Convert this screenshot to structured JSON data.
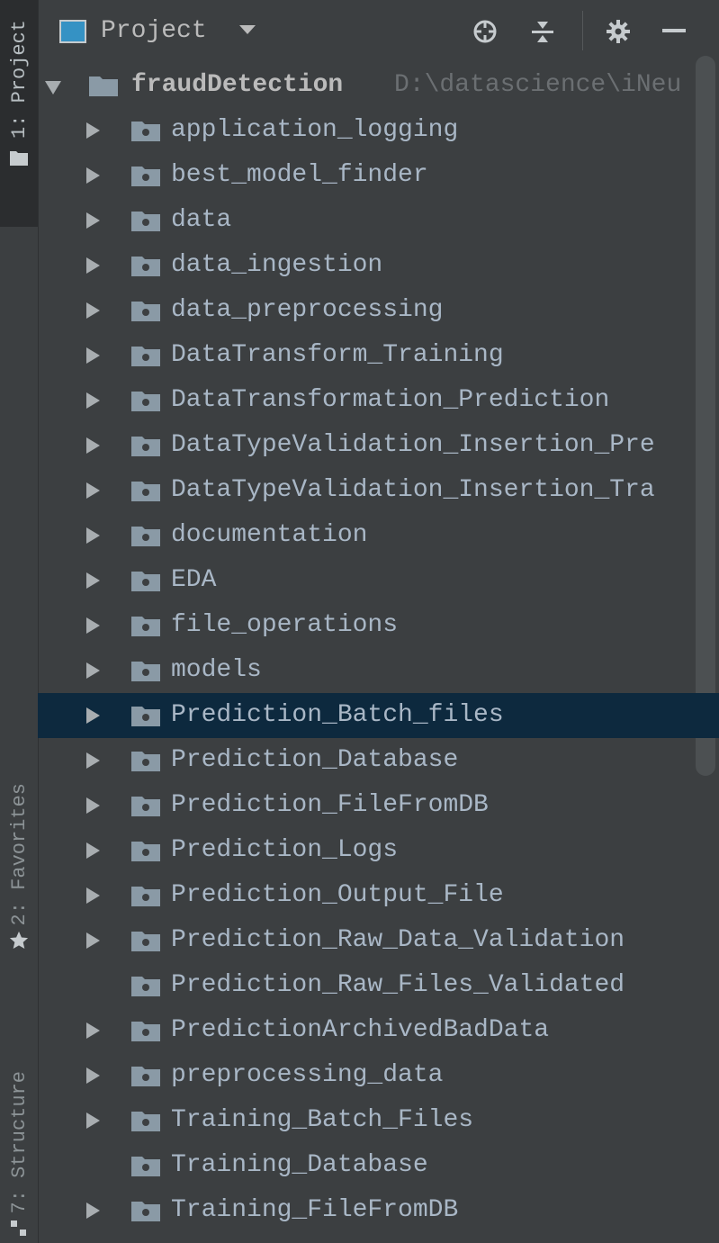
{
  "toolstrip": {
    "project_tab": "1: Project",
    "favorites_tab": "2: Favorites",
    "structure_tab": "7: Structure"
  },
  "header": {
    "title": "Project",
    "actions": [
      "locate-icon",
      "collapse-all-icon",
      "gear-icon",
      "minimize-icon"
    ]
  },
  "tree": {
    "root": {
      "name": "fraudDetection",
      "path": "D:\\datascience\\iNeu"
    },
    "items": [
      {
        "label": "application_logging",
        "expandable": true
      },
      {
        "label": "best_model_finder",
        "expandable": true
      },
      {
        "label": "data",
        "expandable": true
      },
      {
        "label": "data_ingestion",
        "expandable": true
      },
      {
        "label": "data_preprocessing",
        "expandable": true
      },
      {
        "label": "DataTransform_Training",
        "expandable": true
      },
      {
        "label": "DataTransformation_Prediction",
        "expandable": true
      },
      {
        "label": "DataTypeValidation_Insertion_Pre",
        "expandable": true
      },
      {
        "label": "DataTypeValidation_Insertion_Tra",
        "expandable": true
      },
      {
        "label": "documentation",
        "expandable": true
      },
      {
        "label": "EDA",
        "expandable": true
      },
      {
        "label": "file_operations",
        "expandable": true
      },
      {
        "label": "models",
        "expandable": true
      },
      {
        "label": "Prediction_Batch_files",
        "expandable": true,
        "selected": true
      },
      {
        "label": "Prediction_Database",
        "expandable": true
      },
      {
        "label": "Prediction_FileFromDB",
        "expandable": true
      },
      {
        "label": "Prediction_Logs",
        "expandable": true
      },
      {
        "label": "Prediction_Output_File",
        "expandable": true
      },
      {
        "label": "Prediction_Raw_Data_Validation",
        "expandable": true
      },
      {
        "label": "Prediction_Raw_Files_Validated",
        "expandable": false
      },
      {
        "label": "PredictionArchivedBadData",
        "expandable": true
      },
      {
        "label": "preprocessing_data",
        "expandable": true
      },
      {
        "label": "Training_Batch_Files",
        "expandable": true
      },
      {
        "label": "Training_Database",
        "expandable": false
      },
      {
        "label": "Training_FileFromDB",
        "expandable": true
      }
    ]
  },
  "colors": {
    "background": "#3c3f41",
    "selection": "#0d293e",
    "text": "#a9b7c6",
    "folder": "#8a9aa6"
  }
}
